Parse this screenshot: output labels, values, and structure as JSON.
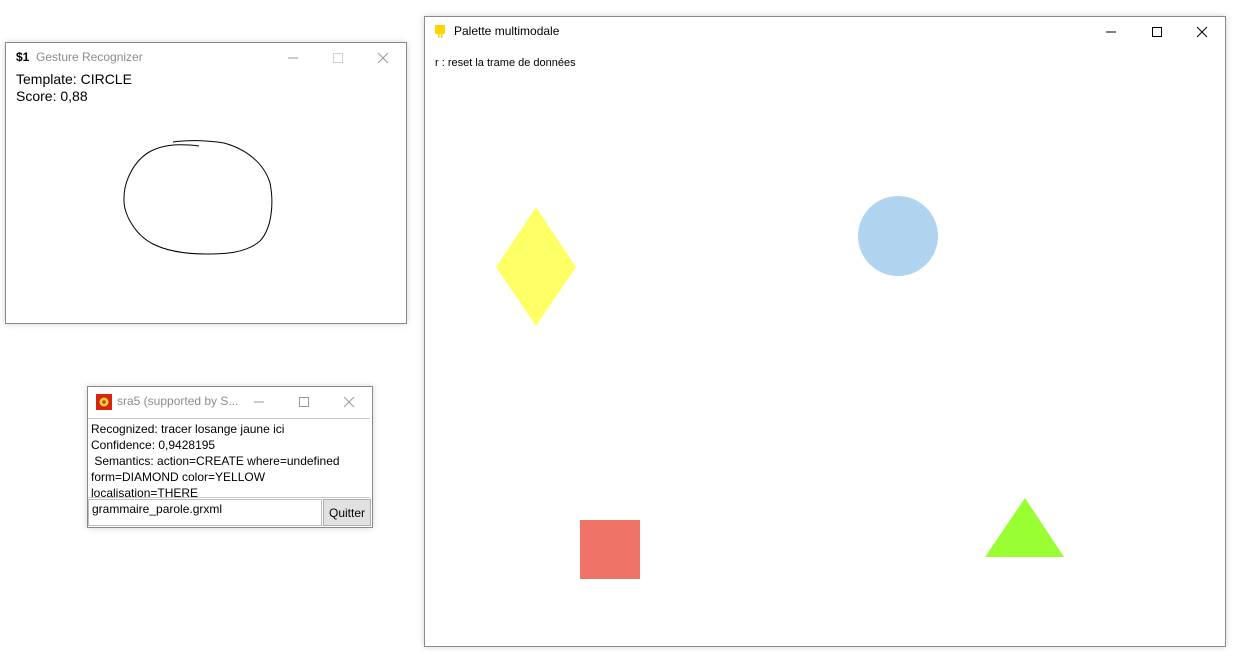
{
  "gesture_window": {
    "icon": "$1",
    "title": "Gesture Recognizer",
    "template": "Template: CIRCLE",
    "score": "Score: 0,88"
  },
  "speech_window": {
    "title": "sra5 (supported by S...",
    "recognized": "Recognized: tracer losange jaune ici",
    "confidence": "Confidence: 0,9428195",
    "semantics_line1": " Semantics: action=CREATE where=undefined",
    "semantics_line2": "form=DIAMOND color=YELLOW localisation=THERE",
    "grammar_file": "grammaire_parole.grxml",
    "quit_label": "Quitter"
  },
  "palette_window": {
    "title": "Palette multimodale",
    "hint": "r : reset la trame de données",
    "shapes": [
      {
        "type": "diamond",
        "color": "#ffff66"
      },
      {
        "type": "circle",
        "color": "#b0d4f0"
      },
      {
        "type": "square",
        "color": "#ee7265"
      },
      {
        "type": "triangle",
        "color": "#99ff33"
      }
    ]
  },
  "icons": {
    "minimize": "minimize-icon",
    "maximize": "maximize-icon",
    "close": "close-icon"
  }
}
